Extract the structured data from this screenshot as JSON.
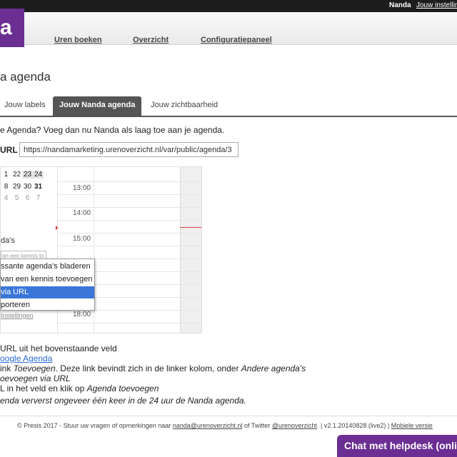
{
  "topbar": {
    "user": "Nanda",
    "settings": "Jouw instellingen"
  },
  "logo": {
    "text": "a"
  },
  "nav": {
    "items": [
      "Uren boeken",
      "Overzicht",
      "Configuratiepaneel"
    ]
  },
  "page": {
    "title": "a agenda"
  },
  "tabs": {
    "items": [
      "Jouw labels",
      "Jouw Nanda agenda",
      "Jouw zichtbaarheid"
    ],
    "active": "Jouw Nanda agenda"
  },
  "intro": "e Agenda? Voeg dan nu Nanda als laag toe aan je agenda.",
  "url": {
    "label": "URL",
    "value": "https://nandamarketing.urenoverzicht.nl/var/public/agenda/3"
  },
  "screenshot": {
    "mini_rows": [
      [
        "1",
        "22",
        "23",
        "24"
      ],
      [
        "8",
        "29",
        "30",
        "31"
      ],
      [
        "4",
        "5",
        "6",
        "7"
      ]
    ],
    "other_label": "da's",
    "kennis_placeholder": "an een kennis to",
    "settings_link": "Instellingen",
    "times": [
      "13:00",
      "14:00",
      "15:00",
      "18:00"
    ],
    "menu": [
      "ssante agenda's bladeren",
      "van een kennis toevoegen",
      "via URL",
      "porteren"
    ],
    "menu_selected": "via URL"
  },
  "steps": {
    "line1": "URL uit het bovenstaande veld",
    "line2_link": "oogle Agenda",
    "line3_pre": "ink ",
    "line3_em": "Toevoegen",
    "line3_post": ". Deze link bevindt zich in de linker kolom, onder ",
    "line3_em2": "Andere agenda's",
    "line4": "oevoegen via URL",
    "line5_pre": "L in het veld en klik op ",
    "line5_em": "Agenda toevoegen"
  },
  "note": "enda ververst ongeveer één keer in de 24 uur de Nanda agenda.",
  "footer": {
    "copyright": "© Presis 2017 - Stuur uw vragen of opmerkingen naar",
    "email": "nanda@urenoverzicht.nl",
    "twitter_pre": "of Twitter",
    "twitter": "@urenoverzicht",
    "version": "v2.1.20140828 (live2)",
    "mobile": "Mobiele versie"
  },
  "chat": {
    "label": "Chat met helpdesk (online)"
  }
}
